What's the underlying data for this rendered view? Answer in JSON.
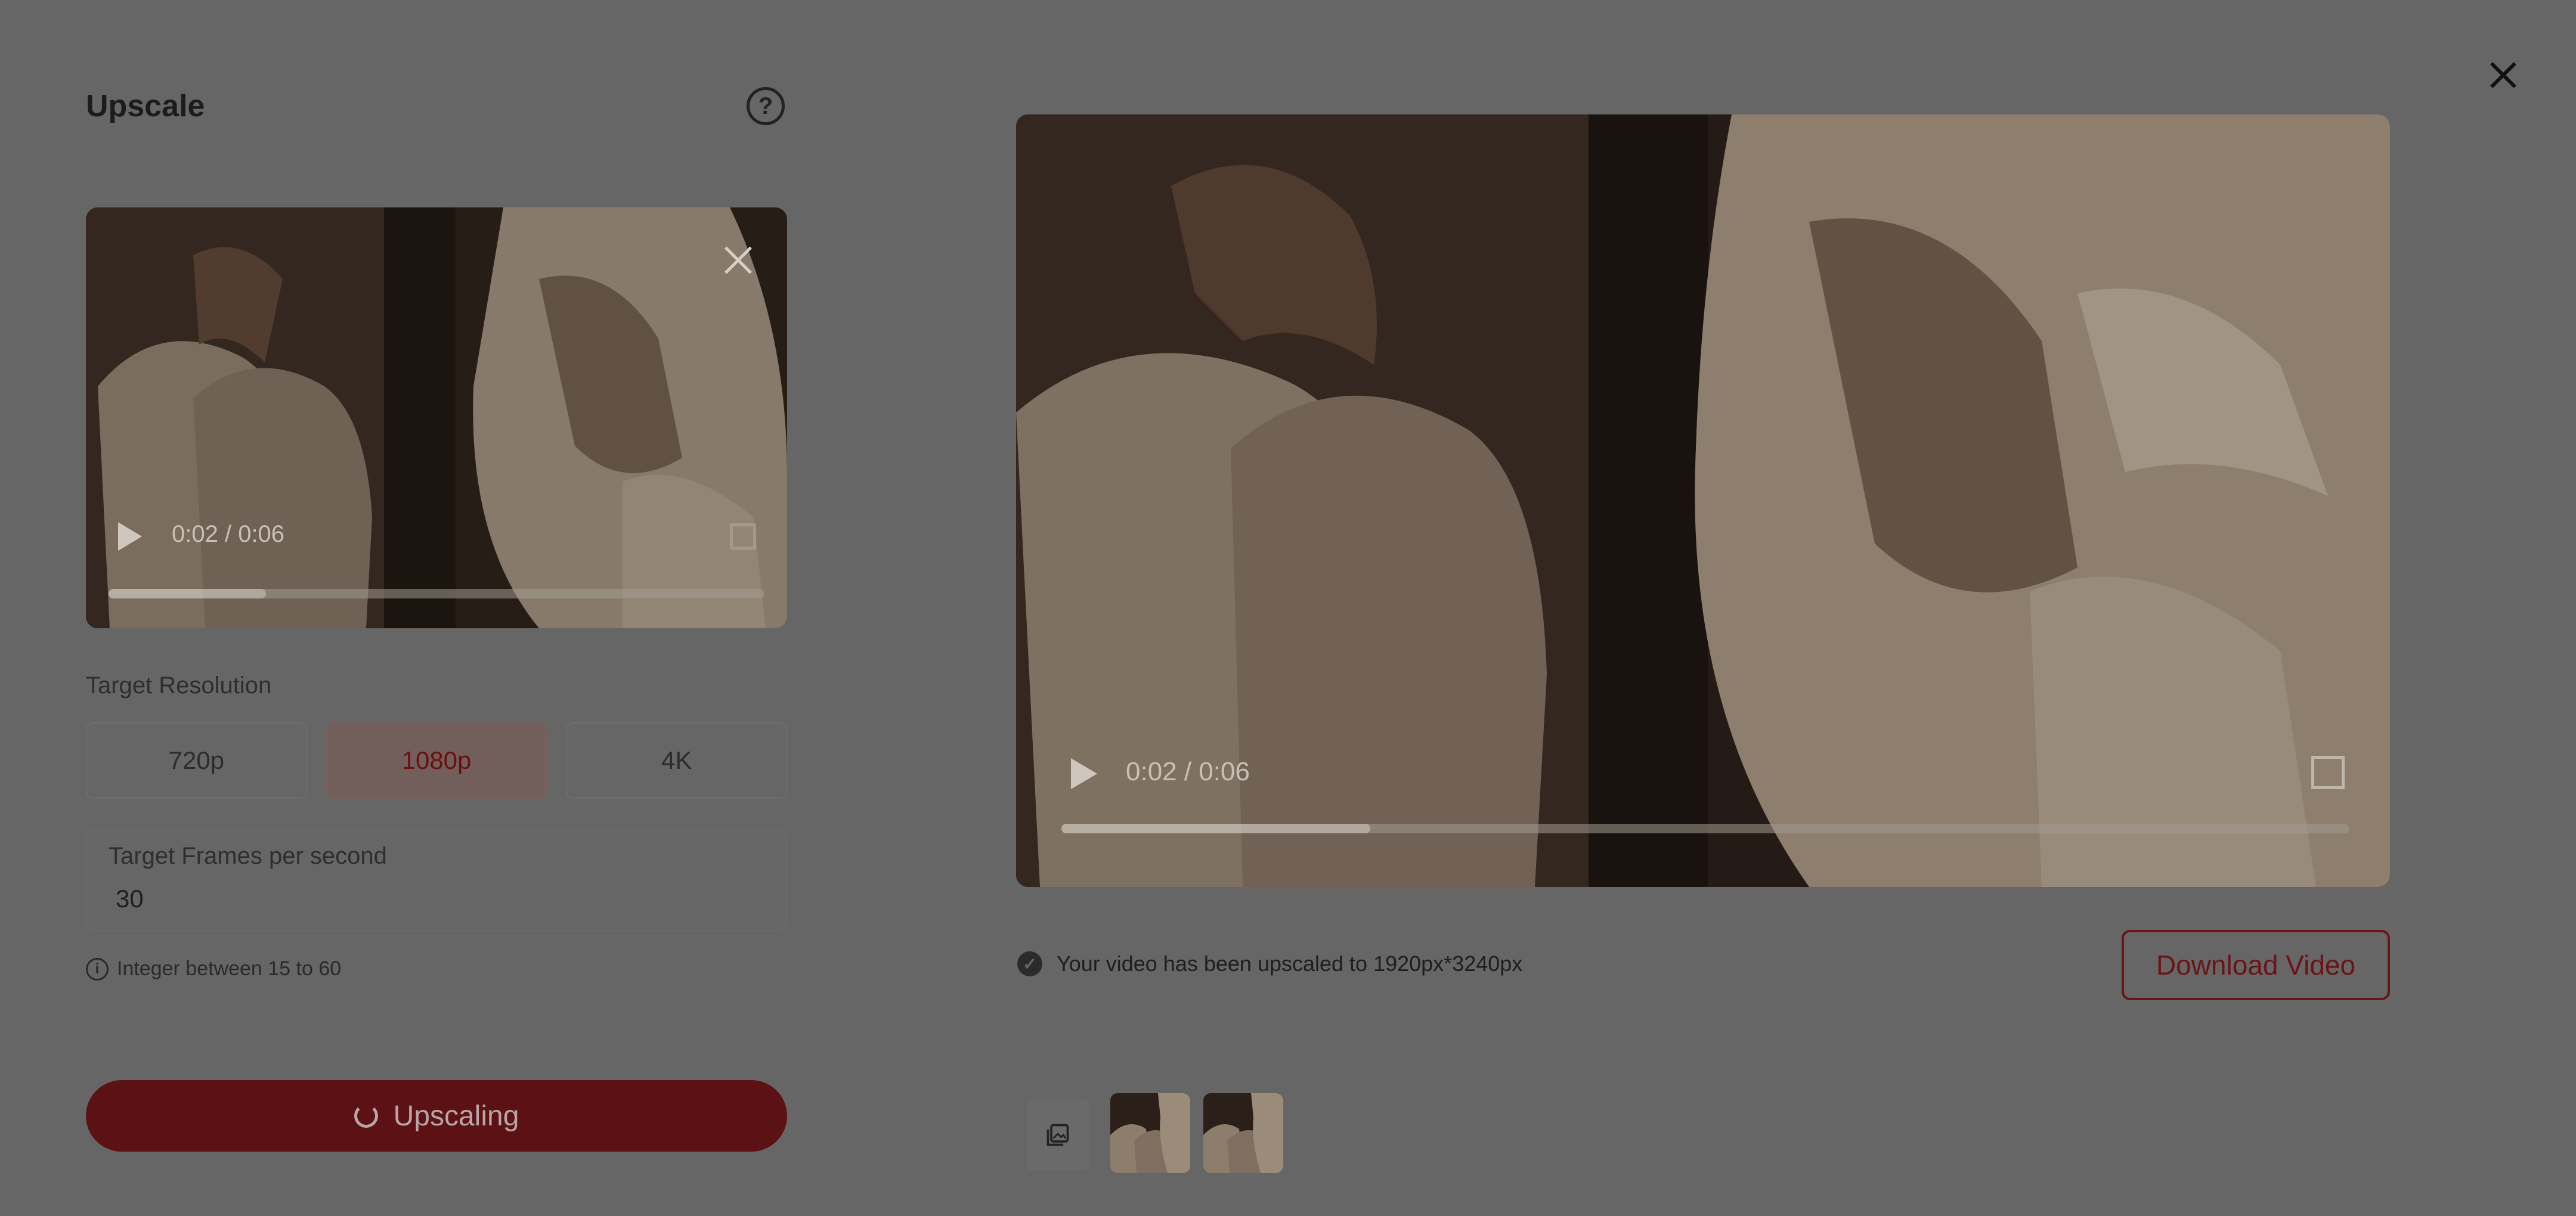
{
  "modal": {
    "title": "Upscale",
    "help_icon": "help-circle-icon",
    "close_icon": "close-icon"
  },
  "source_video": {
    "time": "0:02 / 0:06",
    "progress": 0.24,
    "remove_icon": "close-icon",
    "fullscreen_icon": "fullscreen-icon"
  },
  "settings": {
    "resolution_label": "Target Resolution",
    "resolutions": [
      "720p",
      "1080p",
      "4K"
    ],
    "selected_resolution": "1080p",
    "fps_label": "Target Frames per second",
    "fps_value": "30",
    "fps_hint": "Integer between 15 to 60",
    "info_icon": "info-icon"
  },
  "action": {
    "upscale_label": "Upscaling",
    "spinner_icon": "spinner-icon"
  },
  "result_video": {
    "time": "0:02 / 0:06",
    "progress": 0.24,
    "fullscreen_icon": "fullscreen-icon"
  },
  "result": {
    "status": "Your video has been upscaled to 1920px*3240px",
    "status_icon": "check-circle-icon",
    "download_label": "Download Video"
  },
  "thumbnails": {
    "gallery_icon": "gallery-icon",
    "count": 2
  },
  "colors": {
    "overlay": "#666666",
    "accent": "#6b1317",
    "active_resolution_text": "#6b0f12"
  }
}
